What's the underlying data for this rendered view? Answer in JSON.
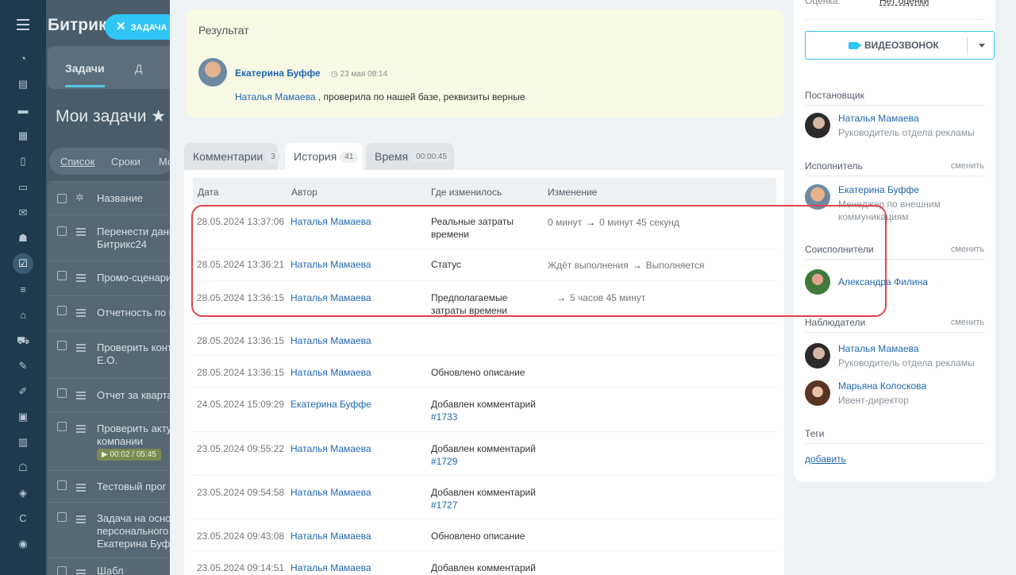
{
  "background": {
    "brand": "Битрик",
    "close_label": "ЗАДАЧА",
    "tab_active": "Задачи",
    "tab_second": "Д",
    "title": "Мои задачи",
    "views": [
      "Список",
      "Сроки",
      "Мо"
    ],
    "column_name": "Название",
    "timer": "▶ 00:02 / 05:45",
    "tasks": [
      "Перенести данн\nБитрикс24",
      "Промо-сценари",
      "Отчетность по м",
      "Проверить конт\nЕ.О.",
      "Отчет за кварта",
      "Проверить акту\nкомпании",
      "Тестовый прог",
      "Задача на основ\nперсонального\nЕкатерина Буфф",
      "Шабл"
    ]
  },
  "result": {
    "heading": "Результат",
    "author": "Екатерина Буффе",
    "time": "◷ 23 мая 08:14",
    "mention": "Наталья Мамаева",
    "text": " , проверила по нашей базе, реквизиты верные"
  },
  "tabs": [
    {
      "label": "Комментарии",
      "count": "3"
    },
    {
      "label": "История",
      "count": "41"
    },
    {
      "label": "Время",
      "count": "00:00:45"
    }
  ],
  "history": {
    "columns": [
      "Дата",
      "Автор",
      "Где изменилось",
      "Изменение"
    ],
    "rows": [
      {
        "date": "28.05.2024 13:37:06",
        "author": "Наталья Мамаева",
        "where": "Реальные затраты времени",
        "link": "",
        "from": "0 минут",
        "to": "0 минут 45 секунд"
      },
      {
        "date": "28.05.2024 13:36:21",
        "author": "Наталья Мамаева",
        "where": "Статус",
        "link": "",
        "from": "Ждёт выполнения",
        "to": "Выполняется"
      },
      {
        "date": "28.05.2024 13:36:15",
        "author": "Наталья Мамаева",
        "where": "Предполагаемые затраты времени",
        "link": "",
        "from": "",
        "to": "5 часов 45 минут"
      },
      {
        "date": "28.05.2024 13:36:15",
        "author": "Наталья Мамаева",
        "where": "",
        "link": "",
        "from": "",
        "to": ""
      },
      {
        "date": "28.05.2024 13:36:15",
        "author": "Наталья Мамаева",
        "where": "Обновлено описание",
        "link": "",
        "from": "",
        "to": ""
      },
      {
        "date": "24.05.2024 15:09:29",
        "author": "Екатерина Буффе",
        "where": "Добавлен комментарий",
        "link": "#1733",
        "from": "",
        "to": ""
      },
      {
        "date": "23.05.2024 09:55:22",
        "author": "Наталья Мамаева",
        "where": "Добавлен комментарий",
        "link": "#1729",
        "from": "",
        "to": ""
      },
      {
        "date": "23.05.2024 09:54:58",
        "author": "Наталья Мамаева",
        "where": "Добавлен комментарий",
        "link": "#1727",
        "from": "",
        "to": ""
      },
      {
        "date": "23.05.2024 09:43:08",
        "author": "Наталья Мамаева",
        "where": "Обновлено описание",
        "link": "",
        "from": "",
        "to": ""
      },
      {
        "date": "23.05.2024 09:14:51",
        "author": "Наталья Мамаева",
        "where": "Добавлен комментарий",
        "link": "",
        "from": "",
        "to": ""
      }
    ]
  },
  "sidebar": {
    "evaluation_label": "Оценка:",
    "evaluation_value": "Нет оценки",
    "video_call": "ВИДЕОЗВОНОК",
    "change": "сменить",
    "creator_label": "Постановщик",
    "creator": {
      "name": "Наталья Мамаева",
      "position": "Руководитель отдела рекламы"
    },
    "responsible_label": "Исполнитель",
    "responsible": {
      "name": "Екатерина Буффе",
      "position": "Менеджер по внешним коммуникациям"
    },
    "accomplices_label": "Соисполнители",
    "accomplice": {
      "name": "Александра Филина"
    },
    "auditors_label": "Наблюдатели",
    "auditors": [
      {
        "name": "Наталья Мамаева",
        "position": "Руководитель отдела рекламы"
      },
      {
        "name": "Марьяна Колоскова",
        "position": "Ивент-директор"
      }
    ],
    "tags_label": "Теги",
    "tags_add": "добавить"
  }
}
